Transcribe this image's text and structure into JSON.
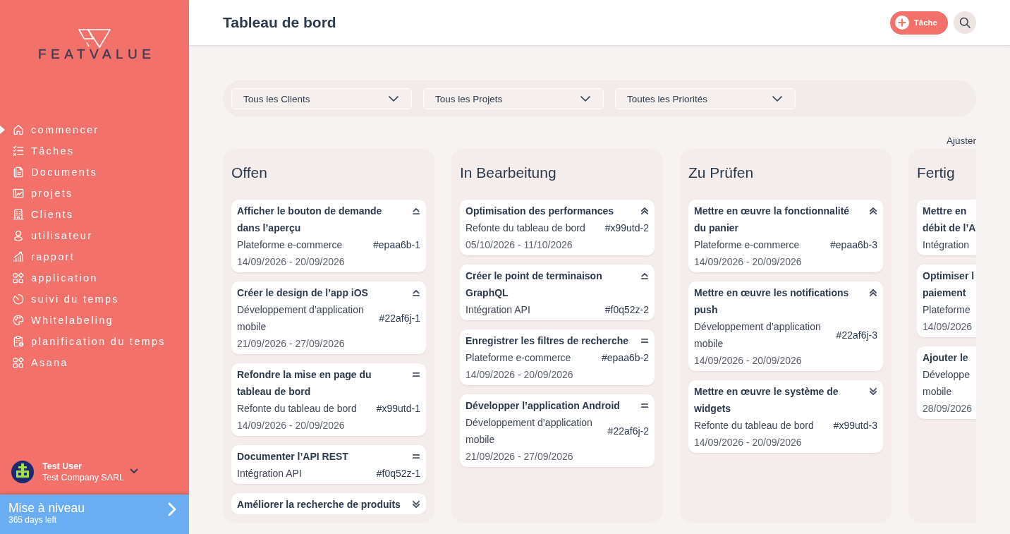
{
  "sidebar": {
    "logo": "FEATVALUE",
    "nav": [
      {
        "label": "commencer",
        "selected": true
      },
      {
        "label": "Tâches",
        "selected": false
      },
      {
        "label": "Documents",
        "selected": false
      },
      {
        "label": "projets",
        "selected": false
      },
      {
        "label": "Clients",
        "selected": false
      },
      {
        "label": "utilisateur",
        "selected": false
      },
      {
        "label": "rapport",
        "selected": false
      },
      {
        "label": "application",
        "selected": false
      },
      {
        "label": "suivi du temps",
        "selected": false
      },
      {
        "label": "Whitelabeling",
        "selected": false
      },
      {
        "label": "planification du temps",
        "selected": false
      },
      {
        "label": "Asana",
        "selected": false
      }
    ],
    "user": {
      "name": "Test User",
      "company": "Test Company SARL"
    },
    "upgrade": {
      "title": "Mise à niveau",
      "days_left": "365 days left"
    }
  },
  "header": {
    "title": "Tableau de bord",
    "add_button": "Tâche"
  },
  "filters": [
    "Tous les Clients",
    "Tous les Projets",
    "Toutes les Priorités"
  ],
  "adjust": "Ajuster",
  "columns": [
    {
      "title": "Offen",
      "cards": [
        {
          "title": "Afficher le bouton de demande dans l’aperçu",
          "priority": {
            "kind": "high"
          },
          "project": "Plateforme e-commerce",
          "ref": "#epaa6b-1",
          "dates": "14/09/2026 - 20/09/2026"
        },
        {
          "title": "Créer le design de l’app iOS",
          "priority": {
            "kind": "high"
          },
          "project": "Développement d’application mobile",
          "ref": "#22af6j-1",
          "dates": "21/09/2026 - 27/09/2026"
        },
        {
          "title": "Refondre la mise en page du tableau de bord",
          "priority": {
            "kind": "medium"
          },
          "project": "Refonte du tableau de bord",
          "ref": "#x99utd-1",
          "dates": "14/09/2026 - 20/09/2026"
        },
        {
          "title": "Documenter l’API REST",
          "priority": {
            "kind": "medium"
          },
          "project": "Intégration API",
          "ref": "#f0q52z-1"
        },
        {
          "title": "Améliorer la recherche de produits",
          "priority": {
            "kind": "lowest"
          }
        }
      ]
    },
    {
      "title": "In Bearbeitung",
      "cards": [
        {
          "title": "Optimisation des performances",
          "priority": {
            "kind": "highest"
          },
          "project": "Refonte du tableau de bord",
          "ref": "#x99utd-2",
          "dates": "05/10/2026 - 11/10/2026"
        },
        {
          "title": "Créer le point de terminaison GraphQL",
          "priority": {
            "kind": "high"
          },
          "project": "Intégration API",
          "ref": "#f0q52z-2"
        },
        {
          "title": "Enregistrer les filtres de recherche",
          "priority": {
            "kind": "medium"
          },
          "project": "Plateforme e-commerce",
          "ref": "#epaa6b-2",
          "dates": "14/09/2026 - 20/09/2026"
        },
        {
          "title": "Développer l’application Android",
          "priority": {
            "kind": "medium"
          },
          "project": "Développement d’application mobile",
          "ref": "#22af6j-2",
          "dates": "21/09/2026 - 27/09/2026"
        }
      ]
    },
    {
      "title": "Zu Prüfen",
      "cards": [
        {
          "title": "Mettre en œuvre la fonctionnalité du panier",
          "priority": {
            "kind": "highest"
          },
          "project": "Plateforme e-commerce",
          "ref": "#epaa6b-3",
          "dates": "14/09/2026 - 20/09/2026"
        },
        {
          "title": "Mettre en œuvre les notifications push",
          "priority": {
            "kind": "highest"
          },
          "project": "Développement d’application mobile",
          "ref": "#22af6j-3",
          "dates": "14/09/2026 - 20/09/2026"
        },
        {
          "title": "Mettre en œuvre le système de widgets",
          "priority": {
            "kind": "lowest"
          },
          "project": "Refonte du tableau de bord",
          "ref": "#x99utd-3",
          "dates": "14/09/2026 - 20/09/2026"
        }
      ]
    },
    {
      "title": "Fertig",
      "cards": [
        {
          "title": "Mettre en débit de l’A",
          "project": "Intégration"
        },
        {
          "title": "Optimiser l paiement",
          "project": "Plateforme",
          "dates": "14/09/2026"
        },
        {
          "title": "Ajouter le",
          "project": "Développe mobile",
          "dates": "28/09/2026"
        }
      ]
    }
  ]
}
